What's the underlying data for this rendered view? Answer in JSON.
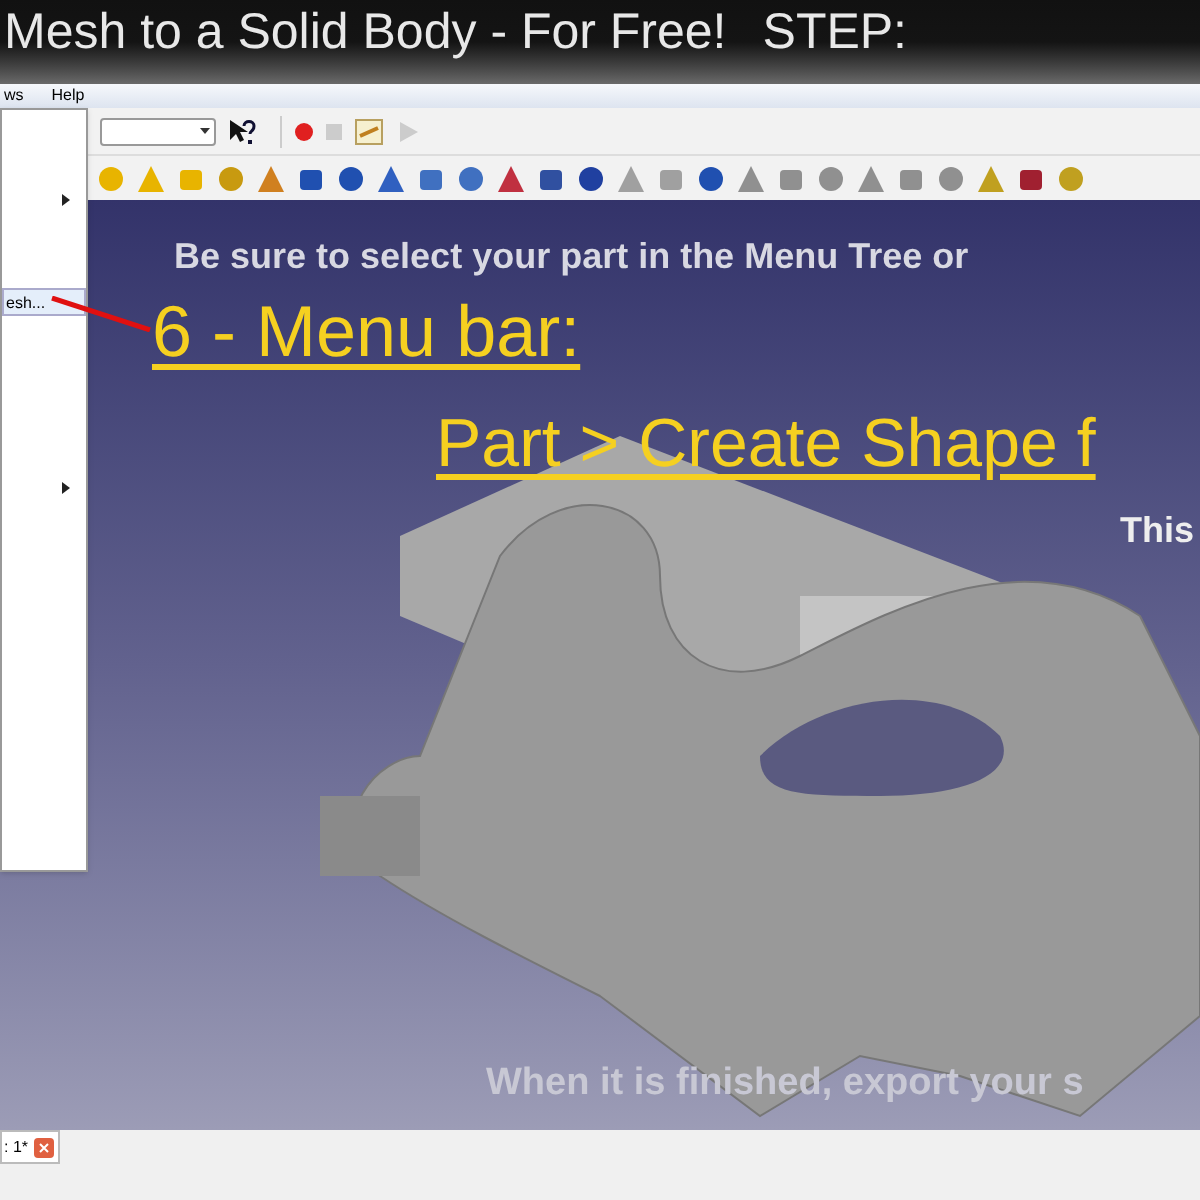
{
  "video_title": {
    "text": "Mesh to a Solid Body - For Free!",
    "step": "STEP:"
  },
  "menu_bar": {
    "items": [
      {
        "label": "ws",
        "selected": false
      },
      {
        "label": "Help",
        "selected": false
      }
    ]
  },
  "dropdown_menu": {
    "items": [
      {
        "kind": "blank"
      },
      {
        "kind": "submenu"
      },
      {
        "kind": "blank"
      },
      {
        "kind": "item",
        "label": "esh...",
        "selected": true
      },
      {
        "kind": "blank"
      },
      {
        "kind": "submenu"
      },
      {
        "kind": "blank"
      }
    ]
  },
  "macro_toolbar": {
    "record_button": {
      "on": true
    }
  },
  "viewport": {
    "instruction": "Be sure to select your part in the Menu Tree or",
    "step_heading": "6 - Menu bar:",
    "menu_path": "Part > Create Shape f",
    "note": "This",
    "footer": "When it is finished, export your s"
  },
  "document_tabs": [
    {
      "label": ": 1*",
      "selected": true
    }
  ]
}
